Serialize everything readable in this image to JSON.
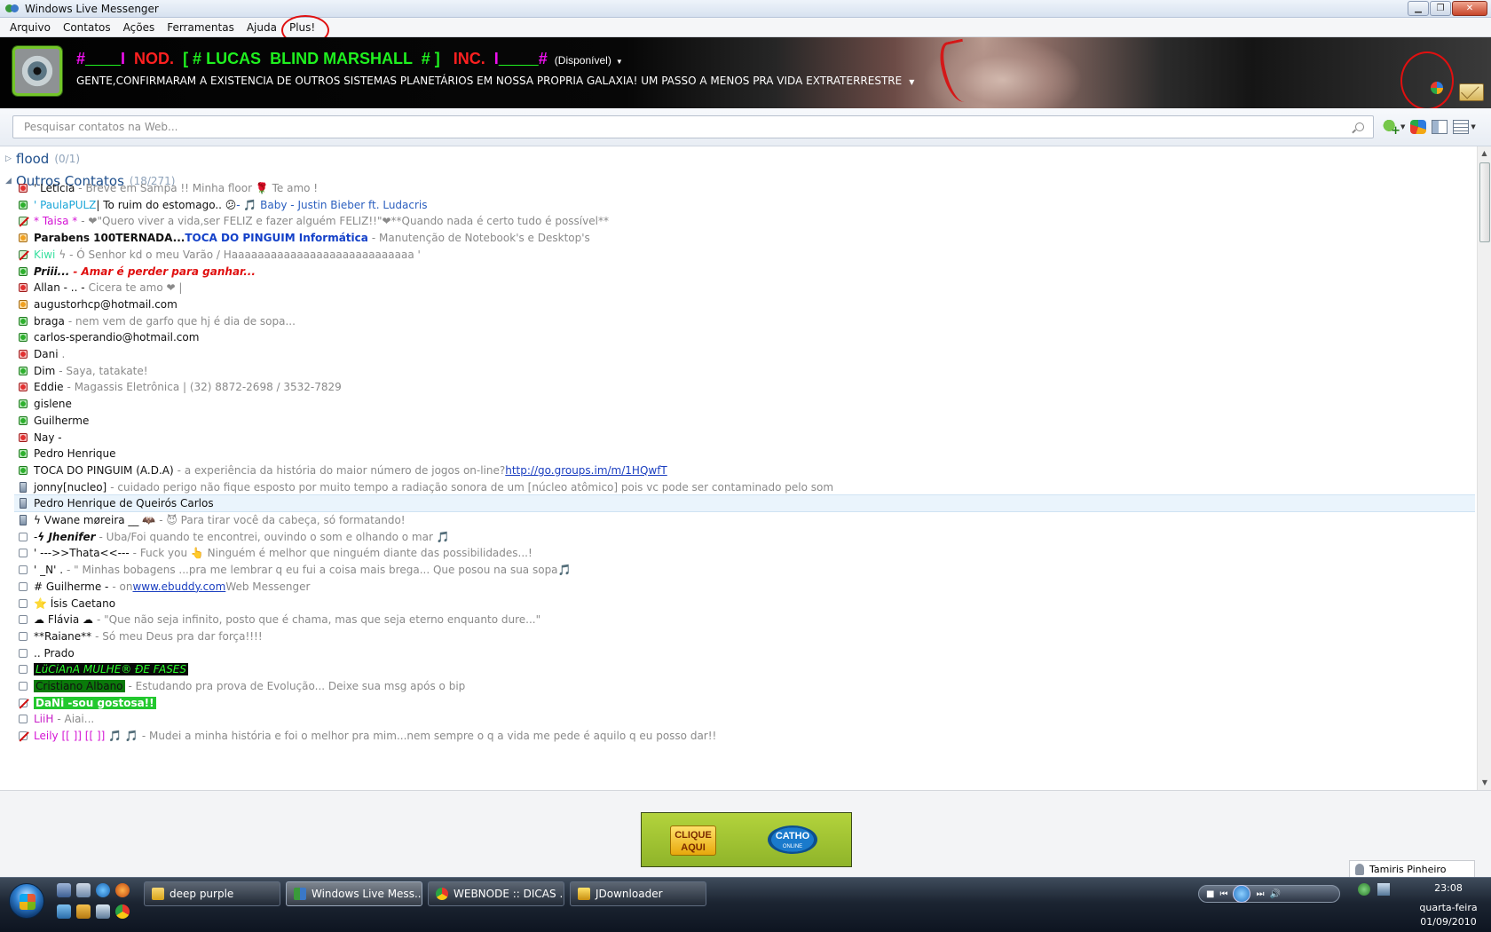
{
  "window": {
    "title": "Windows Live Messenger"
  },
  "menu": [
    "Arquivo",
    "Contatos",
    "Ações",
    "Ferramentas",
    "Ajuda",
    "Plus!"
  ],
  "profile": {
    "name_parts": [
      "#",
      "        ",
      "I",
      "  NOD.  ",
      "[ # LUCAS  BLIND MARSHALL  # ]",
      "   INC.  ",
      "I",
      "         ",
      "#"
    ],
    "status": "(Disponível)",
    "personal_message": "GENTE,CONFIRMARAM A EXISTENCIA DE OUTROS SISTEMAS PLANETÁRIOS EM NOSSA PROPRIA GALAXIA! UM PASSO A MENOS PRA VIDA EXTRATERRESTRE"
  },
  "search": {
    "placeholder": "Pesquisar contatos na Web..."
  },
  "groups": [
    {
      "name": "flood",
      "count": "(0/1)"
    },
    {
      "name": "Outros Contatos",
      "count": "(18/271)"
    }
  ],
  "contacts": [
    {
      "status": "busy",
      "name": "'                  Letícia",
      "msg": "- Breve em Sampa !!                   Minha floor 🌹 Te amo !"
    },
    {
      "status": "online",
      "name": "'      PaulaPULZ",
      "name2": "  |  To ruim do estomago.. 😕",
      "song": " - 🎵 Baby - Justin Bieber ft. Ludacris"
    },
    {
      "status": "blocked",
      "name": "* Taisa *",
      "msg": " - ❤\"Quero viver a vida,ser FELIZ e fazer alguém FELIZ!!\"❤**Quando nada é certo tudo é possível**"
    },
    {
      "status": "away",
      "name": "Parabens 100TERNADA...",
      "name2": "TOCA DO PINGUIM Informática",
      "msg": " - Manutenção de Notebook's e Desktop's"
    },
    {
      "status": "blocked",
      "name": "Kiwi",
      "msg": "                ϟ - Ó Senhor kd o meu Varão /        Haaaaaaaaaaaaaaaaaaaaaaaaaaaa '"
    },
    {
      "status": "online",
      "name": "            Priii...",
      "msg": "           - Amar é perder para ganhar..."
    },
    {
      "status": "busy",
      "name": "Allan - .. -",
      "msg": " Cicera te amo ❤ |"
    },
    {
      "status": "away",
      "name": "augustorhcp@hotmail.com",
      "msg": ""
    },
    {
      "status": "online",
      "name": "braga",
      "msg": " - nem vem de garfo que hj é dia de sopa..."
    },
    {
      "status": "online",
      "name": "carlos-sperandio@hotmail.com",
      "msg": ""
    },
    {
      "status": "busy",
      "name": "Dani",
      "msg": "                                                        ."
    },
    {
      "status": "online",
      "name": "Dim",
      "msg": " - Saya, tatakate!"
    },
    {
      "status": "busy",
      "name": "Eddie",
      "msg": " - Magassis Eletrônica | (32) 8872-2698 / 3532-7829"
    },
    {
      "status": "online",
      "name": "gislene",
      "msg": ""
    },
    {
      "status": "online",
      "name": "Guilherme",
      "msg": ""
    },
    {
      "status": "busy",
      "name": "Nay  -",
      "msg": ""
    },
    {
      "status": "online",
      "name": "Pedro Henrique",
      "msg": ""
    },
    {
      "status": "online",
      "name": "TOCA DO PINGUIM (A.D.A)",
      "msg": "  - a experiência da história do maior número de jogos on-line?  ",
      "link": "http://go.groups.im/m/1HQwfT"
    },
    {
      "status": "mobile",
      "name": "jonny[nucleo]",
      "msg": "  - cuidado perigo não fique esposto por muito tempo a radiação sonora de um [núcleo atômico] pois vc pode ser contaminado pelo som"
    },
    {
      "status": "mobile",
      "name": "Pedro Henrique de Queirós Carlos",
      "msg": "",
      "selected": true
    },
    {
      "status": "mobile",
      "name": "ϟ  Vwaոe møreira  __               🦇",
      "msg": "  - 😈 Para tirar você da cabeça, só formatando!"
    },
    {
      "status": "offline",
      "name": "-",
      "name2": "ϟ Jhenifer",
      "msg": "  - Uba/Foi quando te encontrei, ouvindo o som e olhando o mar 🎵"
    },
    {
      "status": "offline",
      "name": "'           --->>Thata<<---",
      "msg": " - Fuck you 👆   Ninguém é melhor que ninguém diante das possibilidades...!"
    },
    {
      "status": "offline",
      "name": "'       _N'     .",
      "msg": " - \" Minhas bobagens ...pra me lembrar q eu fui a coisa mais brega... Que posou na sua sopa🎵"
    },
    {
      "status": "offline",
      "name": "# Guilherme -",
      "msg": " - on ",
      "link": "www.ebuddy.com",
      "msg2": " Web Messenger"
    },
    {
      "status": "offline",
      "name": "⭐    Ísis Caetano",
      "msg": ""
    },
    {
      "status": "offline",
      "name": "☁ Flávia  ☁",
      "msg": " - \"Que não seja infinito, posto que é chama, mas que seja eterno enquanto dure...\""
    },
    {
      "status": "offline",
      "name": "**Raiane**",
      "msg": " - Só meu Deus pra dar força!!!!"
    },
    {
      "status": "offline",
      "name": ".. Prado",
      "msg": ""
    },
    {
      "status": "offline",
      "name": "LüCiAnA      MULHE® ÐE FASES",
      "msg": "",
      "style": "hl-black"
    },
    {
      "status": "offline",
      "name": "Cristiano Albano",
      "msg": " - Estudando pra prova de Evolução... Deixe sua msg após o bip",
      "style": "hl-green"
    },
    {
      "status": "blocked-off",
      "name": "DaNi -sou gostosa!!",
      "msg": "",
      "style": "hl-lime"
    },
    {
      "status": "offline",
      "name": "                                                                LiiH",
      "msg": " - Aiai..."
    },
    {
      "status": "blocked-off",
      "name": "Leily   [[ ]] [[ ]]     🎵    🎵",
      "msg": " - Mudei a minha história e foi o melhor pra mim...nem sempre o q a vida me pede é aquilo q eu posso dar!!"
    }
  ],
  "ad": {
    "button": "CLIQUE AQUI",
    "logo": "CATHO",
    "logo_sub": "ONLINE"
  },
  "signed_in_user": "Tamiris Pinheiro",
  "taskbar": {
    "tasks": [
      "deep purple",
      "Windows Live Mess...",
      "WEBNODE :: DICAS ...",
      "JDownloader"
    ],
    "time": "23:08",
    "weekday": "quarta-feira",
    "date": "01/09/2010"
  },
  "colors": {
    "accent": "#1f4f8c",
    "name_magenta": "#ee10ee",
    "name_red": "#ff2020",
    "name_green": "#1ff01f"
  }
}
